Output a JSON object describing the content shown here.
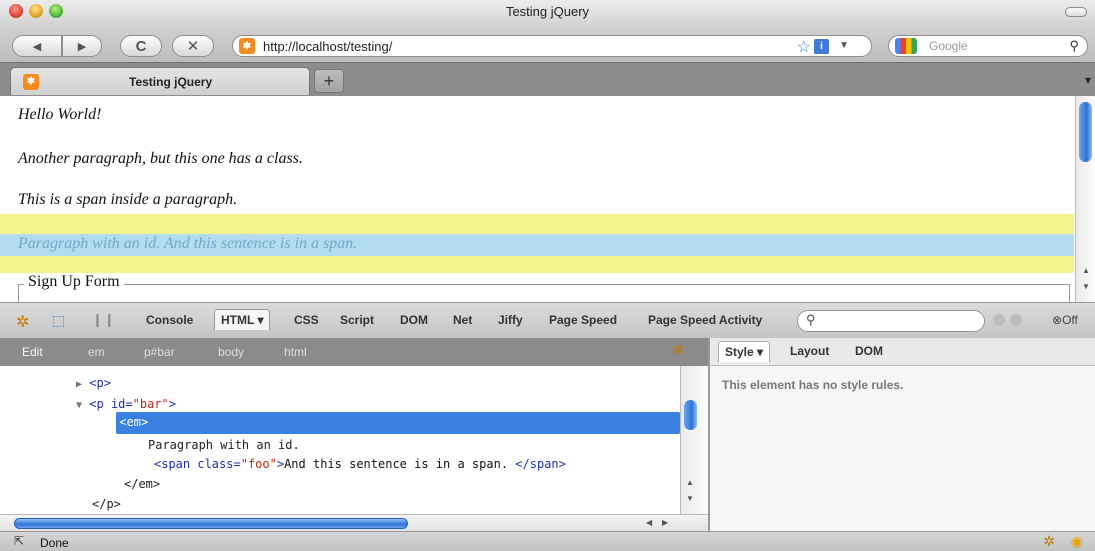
{
  "window": {
    "title": "Testing jQuery"
  },
  "nav": {
    "back_icon": "◀",
    "forward_icon": "▶",
    "reload_icon": "C",
    "stop_icon": "✕",
    "url": "http://localhost/testing/",
    "search_placeholder": "Google"
  },
  "tabs": [
    {
      "label": "Testing jQuery"
    }
  ],
  "new_tab_label": "+",
  "page": {
    "paragraphs": [
      "Hello World!",
      "Another paragraph, but this one has a class.",
      "This is a span inside a paragraph.",
      "Paragraph with an id. And this sentence is in a span."
    ],
    "fieldset_legend": "Sign Up Form",
    "highlight_colors": {
      "yellow": "#f5f48a",
      "blue": "#b3dcee"
    }
  },
  "firebug": {
    "tabs": [
      "Console",
      "HTML ▾",
      "CSS",
      "Script",
      "DOM",
      "Net",
      "Jiffy",
      "Page Speed",
      "Page Speed Activity"
    ],
    "active_tab": "HTML ▾",
    "off_label": "Off",
    "breadcrumbs": [
      "Edit",
      "em",
      "p#bar",
      "body",
      "html"
    ],
    "side_tabs": [
      "Style ▾",
      "Layout",
      "DOM"
    ],
    "side_message": "This element has no style rules.",
    "tree": {
      "p_tag": "<p>",
      "p_bar_open": "<p",
      "p_bar_attr": "id=",
      "p_bar_val": "\"bar\"",
      "p_bar_close": ">",
      "em_open": "<em>",
      "text_line": "Paragraph with an id.",
      "span_open": "<span",
      "span_attr": "class=",
      "span_val": "\"foo\"",
      "span_close_bracket": ">",
      "span_text": "And this sentence is in a span.",
      "span_end": "</span>",
      "em_end": "</em>",
      "p_end": "</p>"
    }
  },
  "status": {
    "text": "Done"
  },
  "accent_color": "#3a80e0"
}
